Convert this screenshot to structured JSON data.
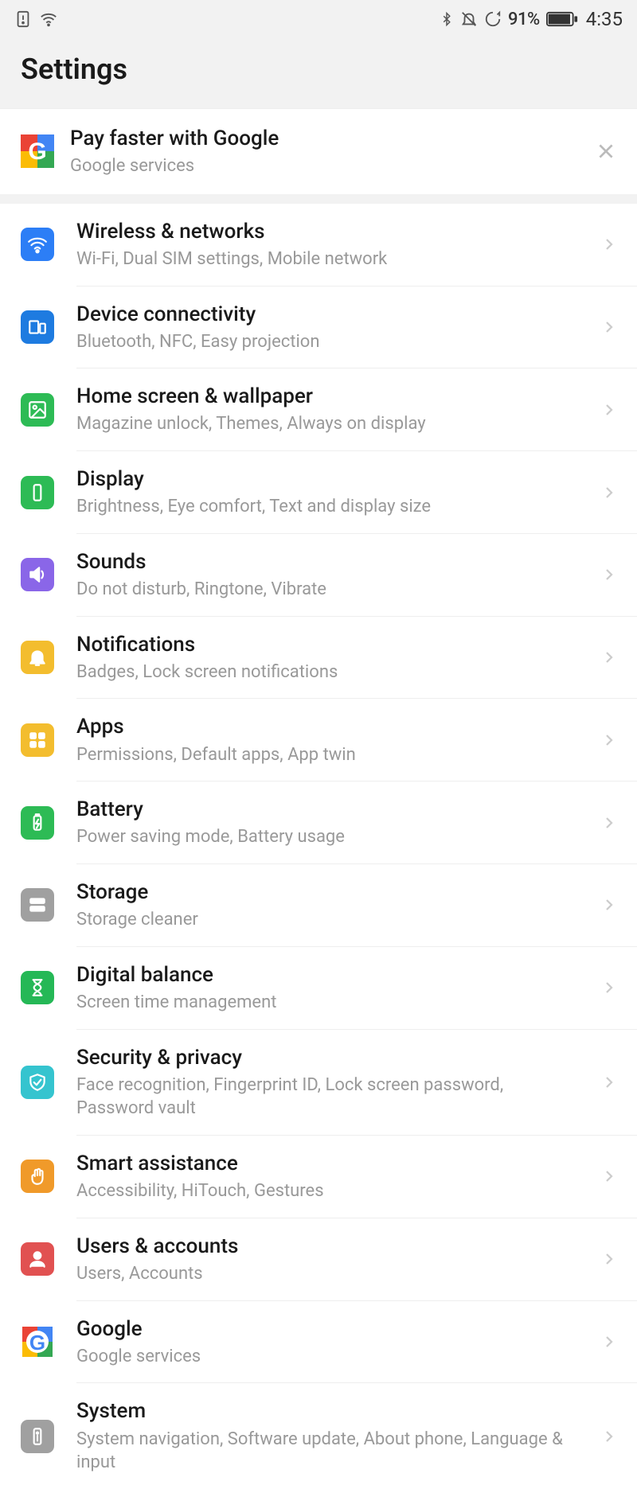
{
  "status": {
    "battery_pct": "91%",
    "time": "4:35"
  },
  "header": {
    "title": "Settings"
  },
  "promo": {
    "title": "Pay faster with Google",
    "subtitle": "Google services"
  },
  "items": [
    {
      "title": "Wireless & networks",
      "subtitle": "Wi-Fi, Dual SIM settings, Mobile network",
      "icon": "wifi",
      "color": "#2c7ef6"
    },
    {
      "title": "Device connectivity",
      "subtitle": "Bluetooth, NFC, Easy projection",
      "icon": "devices",
      "color": "#1e7be0"
    },
    {
      "title": "Home screen & wallpaper",
      "subtitle": "Magazine unlock, Themes, Always on display",
      "icon": "image",
      "color": "#2dbb55"
    },
    {
      "title": "Display",
      "subtitle": "Brightness, Eye comfort, Text and display size",
      "icon": "display",
      "color": "#2dbb55"
    },
    {
      "title": "Sounds",
      "subtitle": "Do not disturb, Ringtone, Vibrate",
      "icon": "sound",
      "color": "#8a66e8"
    },
    {
      "title": "Notifications",
      "subtitle": "Badges, Lock screen notifications",
      "icon": "bell",
      "color": "#f3bd2e"
    },
    {
      "title": "Apps",
      "subtitle": "Permissions, Default apps, App twin",
      "icon": "apps",
      "color": "#f3bd2e"
    },
    {
      "title": "Battery",
      "subtitle": "Power saving mode, Battery usage",
      "icon": "battery",
      "color": "#2dbb55"
    },
    {
      "title": "Storage",
      "subtitle": "Storage cleaner",
      "icon": "storage",
      "color": "#a0a0a0"
    },
    {
      "title": "Digital balance",
      "subtitle": "Screen time management",
      "icon": "hourglass",
      "color": "#25b856"
    },
    {
      "title": "Security & privacy",
      "subtitle": "Face recognition, Fingerprint ID, Lock screen password, Password vault",
      "icon": "shield",
      "color": "#35c4cf"
    },
    {
      "title": "Smart assistance",
      "subtitle": "Accessibility, HiTouch, Gestures",
      "icon": "hand",
      "color": "#f09a2a"
    },
    {
      "title": "Users & accounts",
      "subtitle": "Users, Accounts",
      "icon": "user",
      "color": "#e15151"
    },
    {
      "title": "Google",
      "subtitle": "Google services",
      "icon": "google",
      "color": ""
    },
    {
      "title": "System",
      "subtitle": "System navigation, Software update, About phone, Language & input",
      "icon": "system",
      "color": "#a0a0a0"
    }
  ]
}
